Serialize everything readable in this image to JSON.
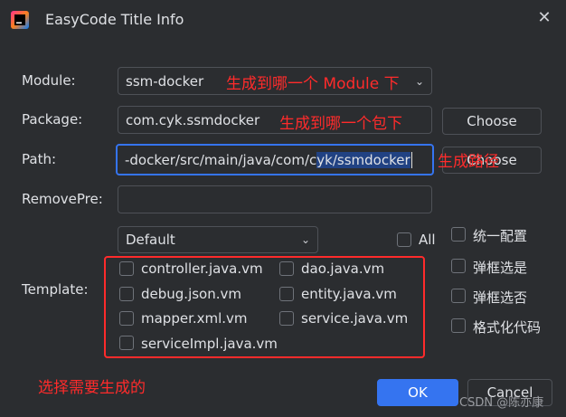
{
  "window": {
    "title": "EasyCode Title Info"
  },
  "form": {
    "module": {
      "label": "Module:",
      "value": "ssm-docker"
    },
    "package": {
      "label": "Package:",
      "value": "com.cyk.ssmdocker",
      "button": "Choose"
    },
    "path": {
      "label": "Path:",
      "value_before": "-docker/src/main/java/com/c",
      "value_selected": "yk/ssmdocker",
      "button": "Choose"
    },
    "remove_pre": {
      "label": "RemovePre:",
      "value": ""
    },
    "template": {
      "label": "Template:",
      "group_value": "Default",
      "all_label": "All",
      "items": [
        "controller.java.vm",
        "dao.java.vm",
        "debug.json.vm",
        "entity.java.vm",
        "mapper.xml.vm",
        "service.java.vm",
        "serviceImpl.java.vm"
      ]
    },
    "options": [
      "统一配置",
      "弹框选是",
      "弹框选否",
      "格式化代码"
    ]
  },
  "annotations": {
    "module": "生成到哪一个 Module 下",
    "package": "生成到哪一个包下",
    "path": "生成路径",
    "template": "选择需要生成的"
  },
  "footer": {
    "ok": "OK",
    "cancel": "Cancel",
    "watermark": "CSDN @陈亦康"
  },
  "colors": {
    "accent": "#3574f0",
    "annotation": "#ff2b2b",
    "background": "#2b2d30"
  }
}
